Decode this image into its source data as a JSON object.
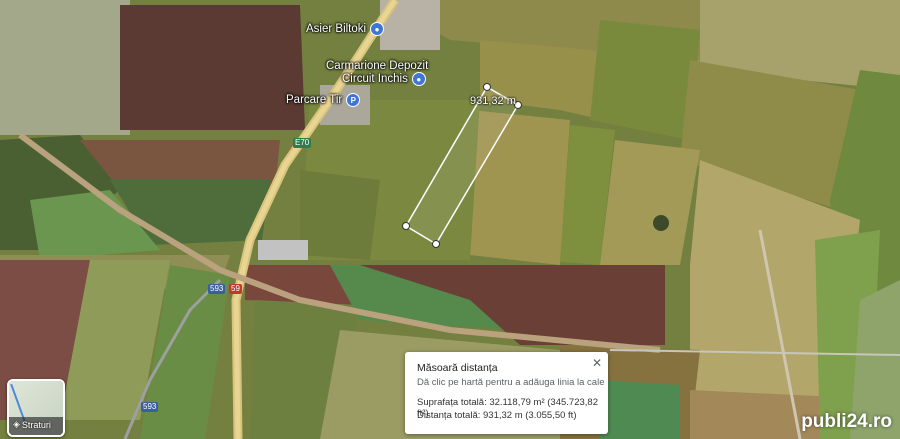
{
  "pois": [
    {
      "name": "Asier Biltoki",
      "icon": "pin-icon"
    },
    {
      "name": "Carmarione Depozit",
      "line2": "Circuit Inchis",
      "icon": "pin-icon"
    },
    {
      "name": "Parcare Tir",
      "icon": "parking-icon"
    }
  ],
  "roads": {
    "e70": "E70",
    "dn593_a": "593",
    "dn593_b": "593",
    "dn59": "59"
  },
  "measurement": {
    "label": "931,32 m"
  },
  "panel": {
    "title": "Măsoară distanța",
    "hint": "Dă clic pe hartă pentru a adăuga linia la cale",
    "area": "Suprafața totală: 32.118,79 m² (345.723,82 ft²)",
    "distance": "Distanța totală: 931,32 m (3.055,50 ft)",
    "close": "✕"
  },
  "layers": {
    "label": "Straturi"
  },
  "watermark": "publi24.ro"
}
